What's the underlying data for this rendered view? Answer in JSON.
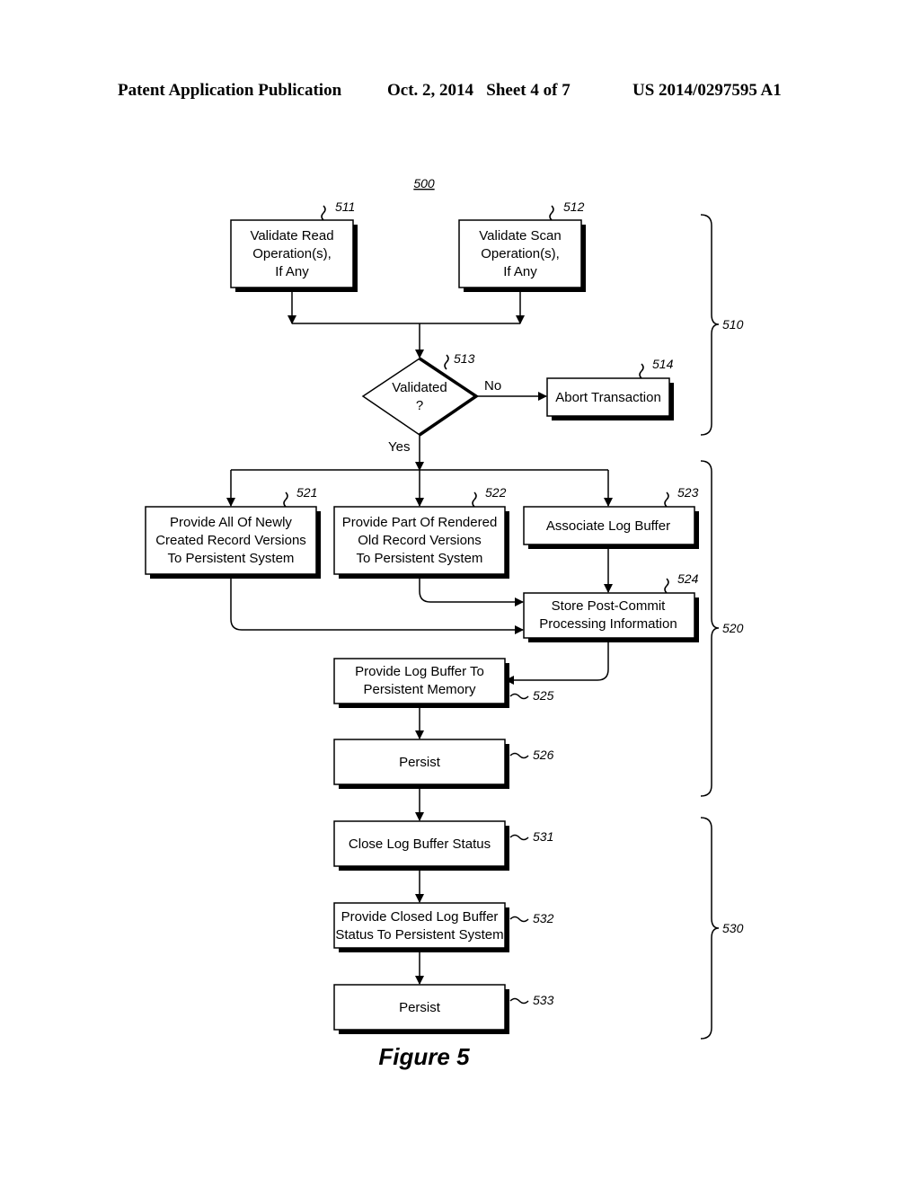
{
  "header": {
    "publication": "Patent Application Publication",
    "date_sheet": "Oct. 2, 2014   Sheet 4 of 7",
    "number": "US 2014/0297595 A1"
  },
  "diagram": {
    "figure_ref": "500",
    "figure_caption": "Figure 5",
    "nodes": {
      "n511": {
        "ref": "511",
        "lines": [
          "Validate Read",
          "Operation(s),",
          "If Any"
        ]
      },
      "n512": {
        "ref": "512",
        "lines": [
          "Validate Scan",
          "Operation(s),",
          "If Any"
        ]
      },
      "n513": {
        "ref": "513",
        "lines": [
          "Validated",
          "?"
        ]
      },
      "n514": {
        "ref": "514",
        "lines": [
          "Abort Transaction"
        ]
      },
      "n521": {
        "ref": "521",
        "lines": [
          "Provide All Of Newly",
          "Created Record Versions",
          "To Persistent System"
        ]
      },
      "n522": {
        "ref": "522",
        "lines": [
          "Provide Part Of Rendered",
          "Old Record Versions",
          "To Persistent System"
        ]
      },
      "n523": {
        "ref": "523",
        "lines": [
          "Associate Log Buffer"
        ]
      },
      "n524": {
        "ref": "524",
        "lines": [
          "Store Post-Commit",
          "Processing Information"
        ]
      },
      "n525": {
        "ref": "525",
        "lines": [
          "Provide Log Buffer To",
          "Persistent Memory"
        ]
      },
      "n526": {
        "ref": "526",
        "lines": [
          "Persist"
        ]
      },
      "n531": {
        "ref": "531",
        "lines": [
          "Close Log Buffer Status"
        ]
      },
      "n532": {
        "ref": "532",
        "lines": [
          "Provide Closed Log Buffer",
          "Status To Persistent System"
        ]
      },
      "n533": {
        "ref": "533",
        "lines": [
          "Persist"
        ]
      }
    },
    "edge_labels": {
      "no": "No",
      "yes": "Yes"
    },
    "groups": {
      "g510": "510",
      "g520": "520",
      "g530": "530"
    }
  }
}
